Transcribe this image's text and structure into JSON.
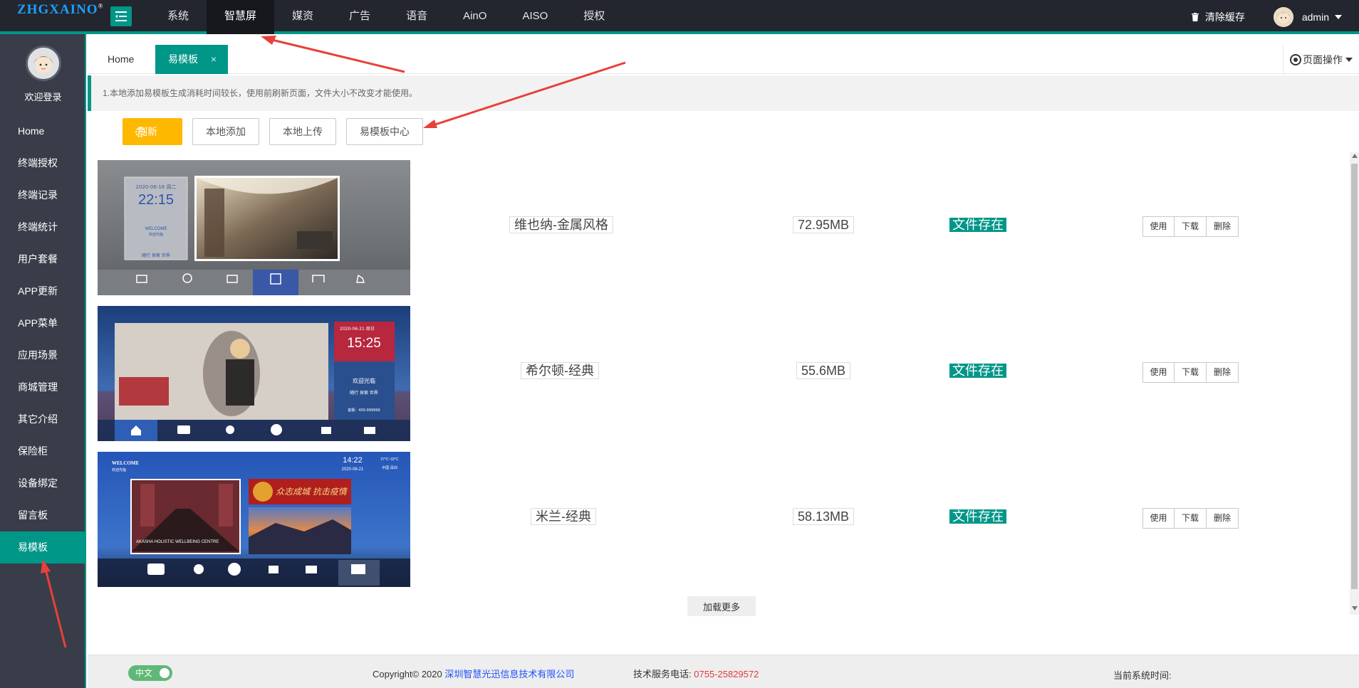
{
  "logo": "ZHGXAINO",
  "logo_mark": "®",
  "topnav": [
    "系统",
    "智慧屏",
    "媒资",
    "广告",
    "语音",
    "AinO",
    "AISO",
    "授权"
  ],
  "top_right": {
    "clear_cache": "清除缓存",
    "user": "admin"
  },
  "sidebar": {
    "welcome": "欢迎登录",
    "items": [
      "Home",
      "终端授权",
      "终端记录",
      "终端统计",
      "用户套餐",
      "APP更新",
      "APP菜单",
      "应用场景",
      "商城管理",
      "其它介绍",
      "保险柜",
      "设备绑定",
      "留言板",
      "易模板"
    ],
    "active_index": 13
  },
  "tabs": {
    "home": "Home",
    "active": "易模板",
    "close": "×",
    "page_ops": "页面操作"
  },
  "notice": "1.本地添加易模板生成消耗时间较长，使用前刷新页面，文件大小不改变才能使用。",
  "toolbar": {
    "refresh": "刷新",
    "local_add": "本地添加",
    "local_upload": "本地上传",
    "template_center": "易模板中心"
  },
  "templates": [
    {
      "name": "维也纳-金属风格",
      "size": "72.95MB",
      "status": "文件存在",
      "thumb": {
        "date": "2020-06-16  周二",
        "time": "22:15",
        "welcome": "WELCOME",
        "sub": "欢迎光临",
        "footer": "随行 探索 世界"
      }
    },
    {
      "name": "希尔顿-经典",
      "size": "55.6MB",
      "status": "文件存在",
      "thumb": {
        "date": "2020-06-21  周日",
        "time": "15:25",
        "welcome": "欢迎光临",
        "sub": "随行 探索 世界",
        "footer": "客服：400-999999"
      }
    },
    {
      "name": "米兰-经典",
      "size": "58.13MB",
      "status": "文件存在",
      "thumb": {
        "welcome": "WELCOME",
        "sub": "欢迎光临",
        "time": "14:22",
        "date": "2020-06-21",
        "weather": "27°C~32°C",
        "city": "中国·深圳",
        "poster": "众志成城 抗击疫情",
        "caption": "AKASHA HOLISTIC WELLBEING CENTRE"
      }
    }
  ],
  "row_ops": {
    "use": "使用",
    "download": "下载",
    "delete": "删除"
  },
  "load_more": "加载更多",
  "footer": {
    "lang": "中文",
    "copyright_prefix": "Copyright© 2020 ",
    "company": "深圳智慧光迅信息技术有限公司",
    "support_label": "技术服务电话: ",
    "phone": "0755-25829572",
    "systime_label": "当前系统时间:"
  },
  "colors": {
    "accent": "#009688",
    "header_bg": "#23262e",
    "sidebar_bg": "#393d49",
    "refresh_btn": "#ffb800",
    "annotation_arrow": "#e8403a"
  }
}
